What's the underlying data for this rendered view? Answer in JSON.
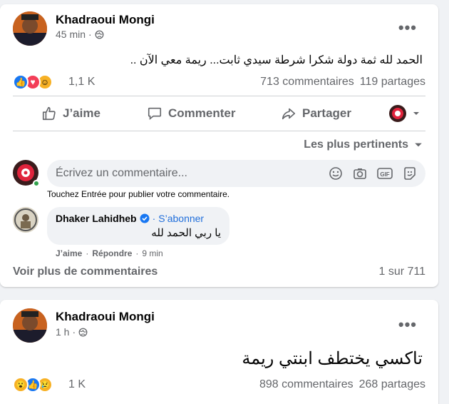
{
  "post1": {
    "author": "Khadraoui Mongi",
    "time": "45 min",
    "text": "الحمد لله ثمة دولة شكرا شرطة سيدي ثابت... ريمة معي الآن ..",
    "reaction_count": "1,1 K",
    "comments": "713 commentaires",
    "shares": "119 partages",
    "actions": {
      "like": "J’aime",
      "comment": "Commenter",
      "share": "Partager"
    },
    "filter": "Les plus pertinents",
    "comment_placeholder": "Écrivez un commentaire...",
    "hint": "Touchez Entrée pour publier votre commentaire.",
    "comment": {
      "name": "Dhaker Lahidheb",
      "follow": "S’abonner",
      "text": "يا ربي الحمد لله",
      "like": "J’aime",
      "reply": "Répondre",
      "time": "9 min"
    },
    "view_more": "Voir plus de commentaires",
    "pager": "1 sur 711"
  },
  "post2": {
    "author": "Khadraoui Mongi",
    "time": "1 h",
    "text": "تاكسي يختطف ابنتي ريمة",
    "reaction_count": "1 K",
    "comments": "898 commentaires",
    "shares": "268 partages"
  },
  "colors": {
    "like_blue": "#1877f2",
    "love_red": "#f33e58",
    "care_yellow": "#f7b125",
    "accent": "#216fdb"
  },
  "icons": [
    "more-icon",
    "globe-icon",
    "like-icon",
    "comment-icon",
    "share-icon",
    "emoji-icon",
    "camera-icon",
    "gif-icon",
    "sticker-icon",
    "verified-icon",
    "chevron-down-icon"
  ]
}
